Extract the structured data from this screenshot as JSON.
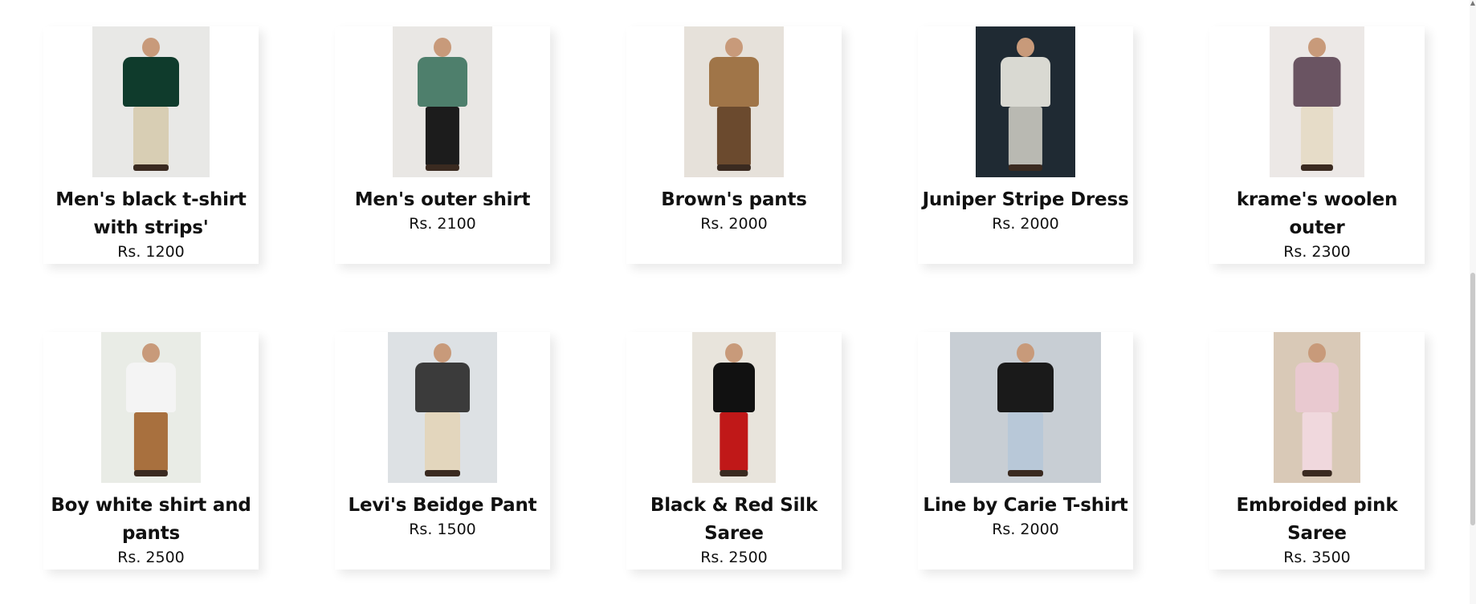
{
  "products": [
    {
      "name": "Men's black t-shirt with strips'",
      "price": "Rs. 1200",
      "img_bg": "#e8e8e6",
      "img_w": 146,
      "top_color": "#0f3b2c",
      "bottom_color": "#d8ceb4",
      "image": "man-green-tshirt-image"
    },
    {
      "name": "Men's outer shirt",
      "price": "Rs. 2100",
      "img_bg": "#e9e7e4",
      "img_w": 124,
      "top_color": "#4e7f6c",
      "bottom_color": "#1c1c1c",
      "image": "man-outer-shirt-image"
    },
    {
      "name": "Brown's pants",
      "price": "Rs. 2000",
      "img_bg": "#e6e1da",
      "img_w": 124,
      "top_color": "#a07548",
      "bottom_color": "#6b4a2e",
      "image": "man-brown-pants-image"
    },
    {
      "name": "Juniper Stripe Dress",
      "price": "Rs. 2000",
      "img_bg": "#1f2a33",
      "img_w": 124,
      "top_color": "#d9d9d2",
      "bottom_color": "#b9b9b2",
      "image": "girl-stripe-dress-image"
    },
    {
      "name": "krame's woolen outer",
      "price": "Rs. 2300",
      "img_bg": "#ece8e6",
      "img_w": 118,
      "top_color": "#6a5462",
      "bottom_color": "#e6dcc8",
      "image": "girl-woolen-outer-image"
    },
    {
      "name": "Boy white shirt and pants",
      "price": "Rs. 2500",
      "img_bg": "#e9ece6",
      "img_w": 124,
      "top_color": "#f4f4f4",
      "bottom_color": "#a8703e",
      "image": "boy-white-shirt-image"
    },
    {
      "name": "Levi's Beidge Pant",
      "price": "Rs. 1500",
      "img_bg": "#dde1e4",
      "img_w": 136,
      "top_color": "#3b3b3b",
      "bottom_color": "#e3d6bd",
      "image": "boy-beige-pant-image"
    },
    {
      "name": "Black & Red Silk Saree",
      "price": "Rs. 2500",
      "img_bg": "#e8e4dc",
      "img_w": 104,
      "top_color": "#111111",
      "bottom_color": "#c01818",
      "image": "woman-red-saree-image"
    },
    {
      "name": "Line by Carie T-shirt",
      "price": "Rs. 2000",
      "img_bg": "#c8ced4",
      "img_w": 188,
      "top_color": "#1a1a1a",
      "bottom_color": "#b8c8d8",
      "image": "woman-striped-tshirt-image"
    },
    {
      "name": "Embroided pink Saree",
      "price": "Rs. 3500",
      "img_bg": "#d9c9b7",
      "img_w": 108,
      "top_color": "#e9c9d0",
      "bottom_color": "#f0d8dd",
      "image": "woman-pink-saree-image"
    }
  ]
}
